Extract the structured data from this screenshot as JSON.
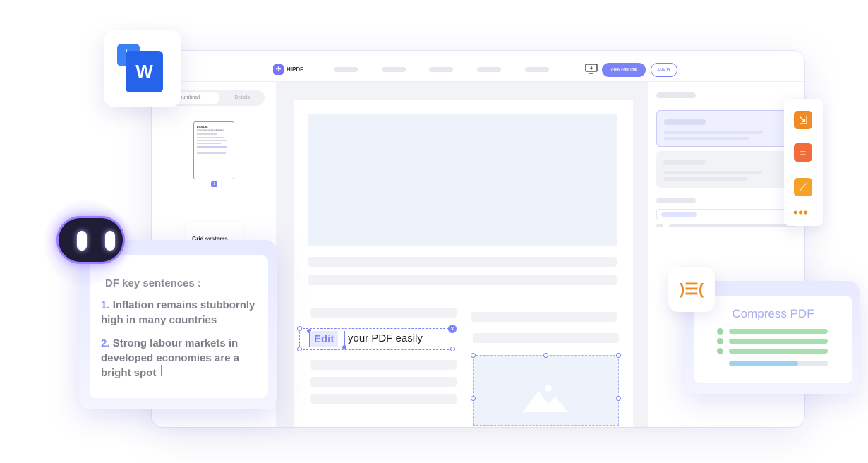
{
  "app": {
    "brand_name": "HIPDF",
    "brand_logo_glyph": "✢",
    "trial_button": "7-Day Free Trial",
    "login_button": "LOG IN"
  },
  "left_panel": {
    "tabs": [
      "humbnail",
      "Details"
    ],
    "thumb1": {
      "title": "ECiβLM.",
      "subtitle": "An environmental publication"
    },
    "page_number": "1",
    "thumb2": {
      "title": "Grid systems"
    }
  },
  "editor": {
    "edit_word": "Edit",
    "edit_rest": "your PDF easily",
    "close_glyph": "×"
  },
  "ai_summary": {
    "heading": "DF key sentences :",
    "items": [
      {
        "num": "1.",
        "text": "Inflation remains stubbornly high in many countries"
      },
      {
        "num": "2.",
        "text": "Strong labour markets in developed economies are a bright spot"
      }
    ]
  },
  "compress": {
    "title": "Compress PDF",
    "progress": 0.7
  },
  "word_card": {
    "front_letter": "W",
    "back_glyph": "↳"
  },
  "tools": {
    "compress_glyph": "⇲",
    "crop_glyph": "⌗",
    "sign_glyph": "⟋",
    "more_glyph": "•••"
  },
  "colors": {
    "accent": "#7b83f5",
    "tool_orange": "#f08a24",
    "word_blue": "#2563eb",
    "check_green": "#a8dfae"
  }
}
